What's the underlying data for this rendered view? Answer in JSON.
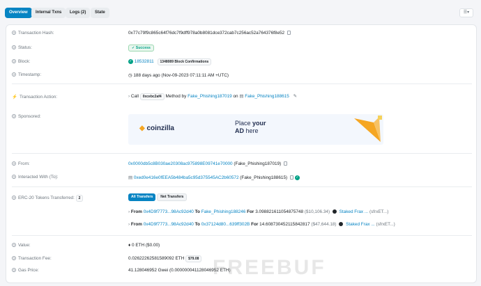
{
  "tabs": [
    {
      "label": "Overview",
      "active": true
    },
    {
      "label": "Internal Txns"
    },
    {
      "label": "Logs (2)"
    },
    {
      "label": "State"
    }
  ],
  "rows": {
    "hash": {
      "label": "Transaction Hash:",
      "value": "0x77c79f9c865c64f76dc7f9dff978a0b8081dce372cab7c256ac52a764376f8e52"
    },
    "status": {
      "label": "Status:",
      "value": "Success"
    },
    "block": {
      "label": "Block:",
      "value": "18532811",
      "confirmations": "1348089 Block Confirmations"
    },
    "timestamp": {
      "label": "Timestamp:",
      "value": "188 days ago (Nov-09-2023 07:11:11 AM +UTC)"
    },
    "action": {
      "label": "Transaction Action:",
      "call": "Call",
      "method_id": "0xcebc2af4",
      "method_by": "Method by",
      "from_name": "Fake_Phishing187019",
      "on": "on",
      "to_name": "Fake_Phishing188615"
    },
    "sponsored": {
      "label": "Sponsored:",
      "ad_brand": "coinzilla",
      "ad_text_1": "Place",
      "ad_text_2": "your",
      "ad_text_3": "AD",
      "ad_text_4": "here"
    },
    "from": {
      "label": "From:",
      "address": "0x0000db5c8B030ae20308ac975898E09741e70000",
      "tag": "(Fake_Phishing187019)"
    },
    "interacted": {
      "label": "Interacted With (To):",
      "address": "0xed0e416e0fEEA5b484ba5c95d375545AC2b60572",
      "tag": "(Fake_Phishing188615)"
    },
    "erc20": {
      "label": "ERC-20 Tokens Transferred:",
      "count": "2",
      "btn_all": "All Transfers",
      "btn_net": "Net Transfers",
      "transfers": [
        {
          "from_word": "From",
          "from": "0x4D9f7773...98Ac92d40",
          "to_word": "To",
          "to": "Fake_Phishing188246",
          "for_word": "For",
          "amount": "3.098821611054875748",
          "usd": "($10,106.34)",
          "token": "Staked Frax ...",
          "symbol": "(sfrxET...)"
        },
        {
          "from_word": "From",
          "from": "0x4D9f7773...98Ac92d40",
          "to_word": "To",
          "to": "0x37124d80...639ff302B",
          "for_word": "For",
          "amount": "14.608730452115842817",
          "usd": "($47,644.18)",
          "token": "Staked Frax ...",
          "symbol": "(sfrxET...)"
        }
      ]
    },
    "value": {
      "label": "Value:",
      "value": "0 ETH ($0.00)"
    },
    "fee": {
      "label": "Transaction Fee:",
      "value": "0.02622262581589092 ETH",
      "usd": "$79.08"
    },
    "gas": {
      "label": "Gas Price:",
      "value": "41.128046952 Gwei (0.000000041128046952 ETH)"
    }
  },
  "watermark": "FREEBUF",
  "icons": {
    "question": "?",
    "clock": "clock-icon",
    "check": "✓",
    "arrow": "›",
    "copy": "copy-icon",
    "edit": "✎",
    "lightning": "⚡"
  },
  "colors": {
    "link": "#0784c3",
    "success": "#00a186",
    "ad_accent": "#f5a623"
  }
}
